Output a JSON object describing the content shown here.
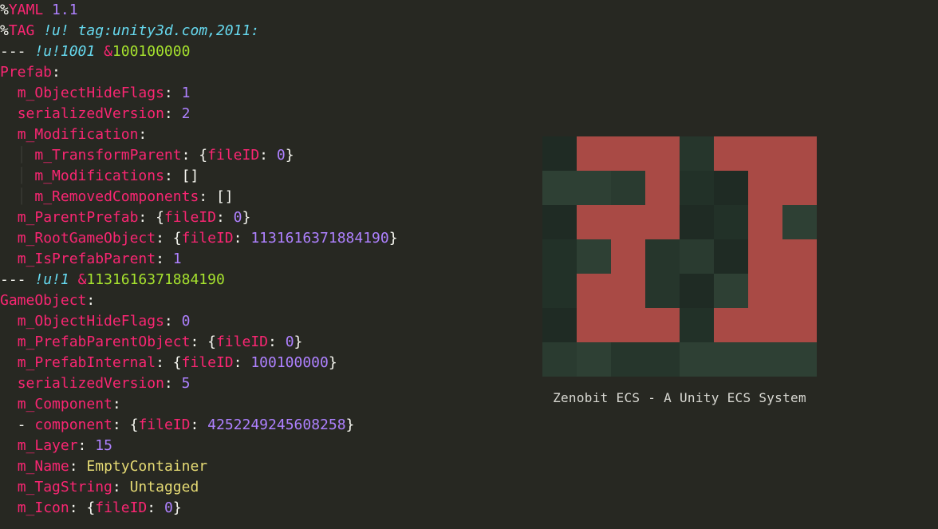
{
  "code": {
    "lines": [
      [
        {
          "t": "%",
          "c": "tk-white"
        },
        {
          "t": "YAML",
          "c": "tk-pink"
        },
        {
          "t": " ",
          "c": "tk-white"
        },
        {
          "t": "1.1",
          "c": "tk-purple"
        }
      ],
      [
        {
          "t": "%",
          "c": "tk-white"
        },
        {
          "t": "TAG",
          "c": "tk-pink"
        },
        {
          "t": " ",
          "c": "tk-white"
        },
        {
          "t": "!u!",
          "c": "tk-blue"
        },
        {
          "t": " ",
          "c": "tk-white"
        },
        {
          "t": "tag:unity3d.com,2011:",
          "c": "tk-blue"
        }
      ],
      [
        {
          "t": "--- ",
          "c": "tk-white"
        },
        {
          "t": "!u!1001",
          "c": "tk-blue"
        },
        {
          "t": " ",
          "c": "tk-white"
        },
        {
          "t": "&",
          "c": "tk-pink"
        },
        {
          "t": "100100000",
          "c": "tk-green"
        }
      ],
      [
        {
          "t": "Prefab",
          "c": "tk-pink"
        },
        {
          "t": ":",
          "c": "tk-white"
        }
      ],
      [
        {
          "t": "  ",
          "c": "tk-white"
        },
        {
          "t": "m_ObjectHideFlags",
          "c": "tk-pink"
        },
        {
          "t": ": ",
          "c": "tk-white"
        },
        {
          "t": "1",
          "c": "tk-purple"
        }
      ],
      [
        {
          "t": "  ",
          "c": "tk-white"
        },
        {
          "t": "serializedVersion",
          "c": "tk-pink"
        },
        {
          "t": ": ",
          "c": "tk-white"
        },
        {
          "t": "2",
          "c": "tk-purple"
        }
      ],
      [
        {
          "t": "  ",
          "c": "tk-white"
        },
        {
          "t": "m_Modification",
          "c": "tk-pink"
        },
        {
          "t": ":",
          "c": "tk-white"
        }
      ],
      [
        {
          "t": "  ",
          "c": "tk-white"
        },
        {
          "t": "│ ",
          "c": "indent-bar"
        },
        {
          "t": "m_TransformParent",
          "c": "tk-pink"
        },
        {
          "t": ": ",
          "c": "tk-white"
        },
        {
          "t": "{",
          "c": "tk-white"
        },
        {
          "t": "fileID",
          "c": "tk-pink"
        },
        {
          "t": ": ",
          "c": "tk-white"
        },
        {
          "t": "0",
          "c": "tk-purple"
        },
        {
          "t": "}",
          "c": "tk-white"
        }
      ],
      [
        {
          "t": "  ",
          "c": "tk-white"
        },
        {
          "t": "│ ",
          "c": "indent-bar"
        },
        {
          "t": "m_Modifications",
          "c": "tk-pink"
        },
        {
          "t": ": []",
          "c": "tk-white"
        }
      ],
      [
        {
          "t": "  ",
          "c": "tk-white"
        },
        {
          "t": "│ ",
          "c": "indent-bar"
        },
        {
          "t": "m_RemovedComponents",
          "c": "tk-pink"
        },
        {
          "t": ": []",
          "c": "tk-white"
        }
      ],
      [
        {
          "t": "  ",
          "c": "tk-white"
        },
        {
          "t": "m_ParentPrefab",
          "c": "tk-pink"
        },
        {
          "t": ": ",
          "c": "tk-white"
        },
        {
          "t": "{",
          "c": "tk-white"
        },
        {
          "t": "fileID",
          "c": "tk-pink"
        },
        {
          "t": ": ",
          "c": "tk-white"
        },
        {
          "t": "0",
          "c": "tk-purple"
        },
        {
          "t": "}",
          "c": "tk-white"
        }
      ],
      [
        {
          "t": "  ",
          "c": "tk-white"
        },
        {
          "t": "m_RootGameObject",
          "c": "tk-pink"
        },
        {
          "t": ": ",
          "c": "tk-white"
        },
        {
          "t": "{",
          "c": "tk-white"
        },
        {
          "t": "fileID",
          "c": "tk-pink"
        },
        {
          "t": ": ",
          "c": "tk-white"
        },
        {
          "t": "1131616371884190",
          "c": "tk-purple"
        },
        {
          "t": "}",
          "c": "tk-white"
        }
      ],
      [
        {
          "t": "  ",
          "c": "tk-white"
        },
        {
          "t": "m_IsPrefabParent",
          "c": "tk-pink"
        },
        {
          "t": ": ",
          "c": "tk-white"
        },
        {
          "t": "1",
          "c": "tk-purple"
        }
      ],
      [
        {
          "t": "--- ",
          "c": "tk-white"
        },
        {
          "t": "!u!1",
          "c": "tk-blue"
        },
        {
          "t": " ",
          "c": "tk-white"
        },
        {
          "t": "&",
          "c": "tk-pink"
        },
        {
          "t": "1131616371884190",
          "c": "tk-green"
        }
      ],
      [
        {
          "t": "GameObject",
          "c": "tk-pink"
        },
        {
          "t": ":",
          "c": "tk-white"
        }
      ],
      [
        {
          "t": "  ",
          "c": "tk-white"
        },
        {
          "t": "m_ObjectHideFlags",
          "c": "tk-pink"
        },
        {
          "t": ": ",
          "c": "tk-white"
        },
        {
          "t": "0",
          "c": "tk-purple"
        }
      ],
      [
        {
          "t": "  ",
          "c": "tk-white"
        },
        {
          "t": "m_PrefabParentObject",
          "c": "tk-pink"
        },
        {
          "t": ": ",
          "c": "tk-white"
        },
        {
          "t": "{",
          "c": "tk-white"
        },
        {
          "t": "fileID",
          "c": "tk-pink"
        },
        {
          "t": ": ",
          "c": "tk-white"
        },
        {
          "t": "0",
          "c": "tk-purple"
        },
        {
          "t": "}",
          "c": "tk-white"
        }
      ],
      [
        {
          "t": "  ",
          "c": "tk-white"
        },
        {
          "t": "m_PrefabInternal",
          "c": "tk-pink"
        },
        {
          "t": ": ",
          "c": "tk-white"
        },
        {
          "t": "{",
          "c": "tk-white"
        },
        {
          "t": "fileID",
          "c": "tk-pink"
        },
        {
          "t": ": ",
          "c": "tk-white"
        },
        {
          "t": "100100000",
          "c": "tk-purple"
        },
        {
          "t": "}",
          "c": "tk-white"
        }
      ],
      [
        {
          "t": "  ",
          "c": "tk-white"
        },
        {
          "t": "serializedVersion",
          "c": "tk-pink"
        },
        {
          "t": ": ",
          "c": "tk-white"
        },
        {
          "t": "5",
          "c": "tk-purple"
        }
      ],
      [
        {
          "t": "  ",
          "c": "tk-white"
        },
        {
          "t": "m_Component",
          "c": "tk-pink"
        },
        {
          "t": ":",
          "c": "tk-white"
        }
      ],
      [
        {
          "t": "  - ",
          "c": "tk-white"
        },
        {
          "t": "component",
          "c": "tk-pink"
        },
        {
          "t": ": ",
          "c": "tk-white"
        },
        {
          "t": "{",
          "c": "tk-white"
        },
        {
          "t": "fileID",
          "c": "tk-pink"
        },
        {
          "t": ": ",
          "c": "tk-white"
        },
        {
          "t": "4252249245608258",
          "c": "tk-purple"
        },
        {
          "t": "}",
          "c": "tk-white"
        }
      ],
      [
        {
          "t": "  ",
          "c": "tk-white"
        },
        {
          "t": "m_Layer",
          "c": "tk-pink"
        },
        {
          "t": ": ",
          "c": "tk-white"
        },
        {
          "t": "15",
          "c": "tk-purple"
        }
      ],
      [
        {
          "t": "  ",
          "c": "tk-white"
        },
        {
          "t": "m_Name",
          "c": "tk-pink"
        },
        {
          "t": ": ",
          "c": "tk-white"
        },
        {
          "t": "EmptyContainer",
          "c": "tk-yellow"
        }
      ],
      [
        {
          "t": "  ",
          "c": "tk-white"
        },
        {
          "t": "m_TagString",
          "c": "tk-pink"
        },
        {
          "t": ": ",
          "c": "tk-white"
        },
        {
          "t": "Untagged",
          "c": "tk-yellow"
        }
      ],
      [
        {
          "t": "  ",
          "c": "tk-white"
        },
        {
          "t": "m_Icon",
          "c": "tk-pink"
        },
        {
          "t": ": ",
          "c": "tk-white"
        },
        {
          "t": "{",
          "c": "tk-white"
        },
        {
          "t": "fileID",
          "c": "tk-pink"
        },
        {
          "t": ": ",
          "c": "tk-white"
        },
        {
          "t": "0",
          "c": "tk-purple"
        },
        {
          "t": "}",
          "c": "tk-white"
        }
      ]
    ]
  },
  "logo": {
    "caption": "Zenobit ECS - A Unity ECS System",
    "grid_size": {
      "cols": 8,
      "rows": 7
    },
    "bg_shades": [
      "#1f2b24",
      "#223128",
      "#26362c",
      "#2a3b30",
      "#2e4034"
    ],
    "fg_color": "#a94a45",
    "fg_cells": [
      [
        0,
        1
      ],
      [
        0,
        2
      ],
      [
        0,
        3
      ],
      [
        0,
        5
      ],
      [
        0,
        6
      ],
      [
        0,
        7
      ],
      [
        1,
        3
      ],
      [
        1,
        6
      ],
      [
        1,
        7
      ],
      [
        2,
        1
      ],
      [
        2,
        2
      ],
      [
        2,
        3
      ],
      [
        2,
        6
      ],
      [
        3,
        2
      ],
      [
        3,
        6
      ],
      [
        3,
        7
      ],
      [
        4,
        1
      ],
      [
        4,
        2
      ],
      [
        4,
        6
      ],
      [
        4,
        7
      ],
      [
        5,
        1
      ],
      [
        5,
        2
      ],
      [
        5,
        3
      ],
      [
        5,
        5
      ],
      [
        5,
        6
      ],
      [
        5,
        7
      ]
    ]
  }
}
